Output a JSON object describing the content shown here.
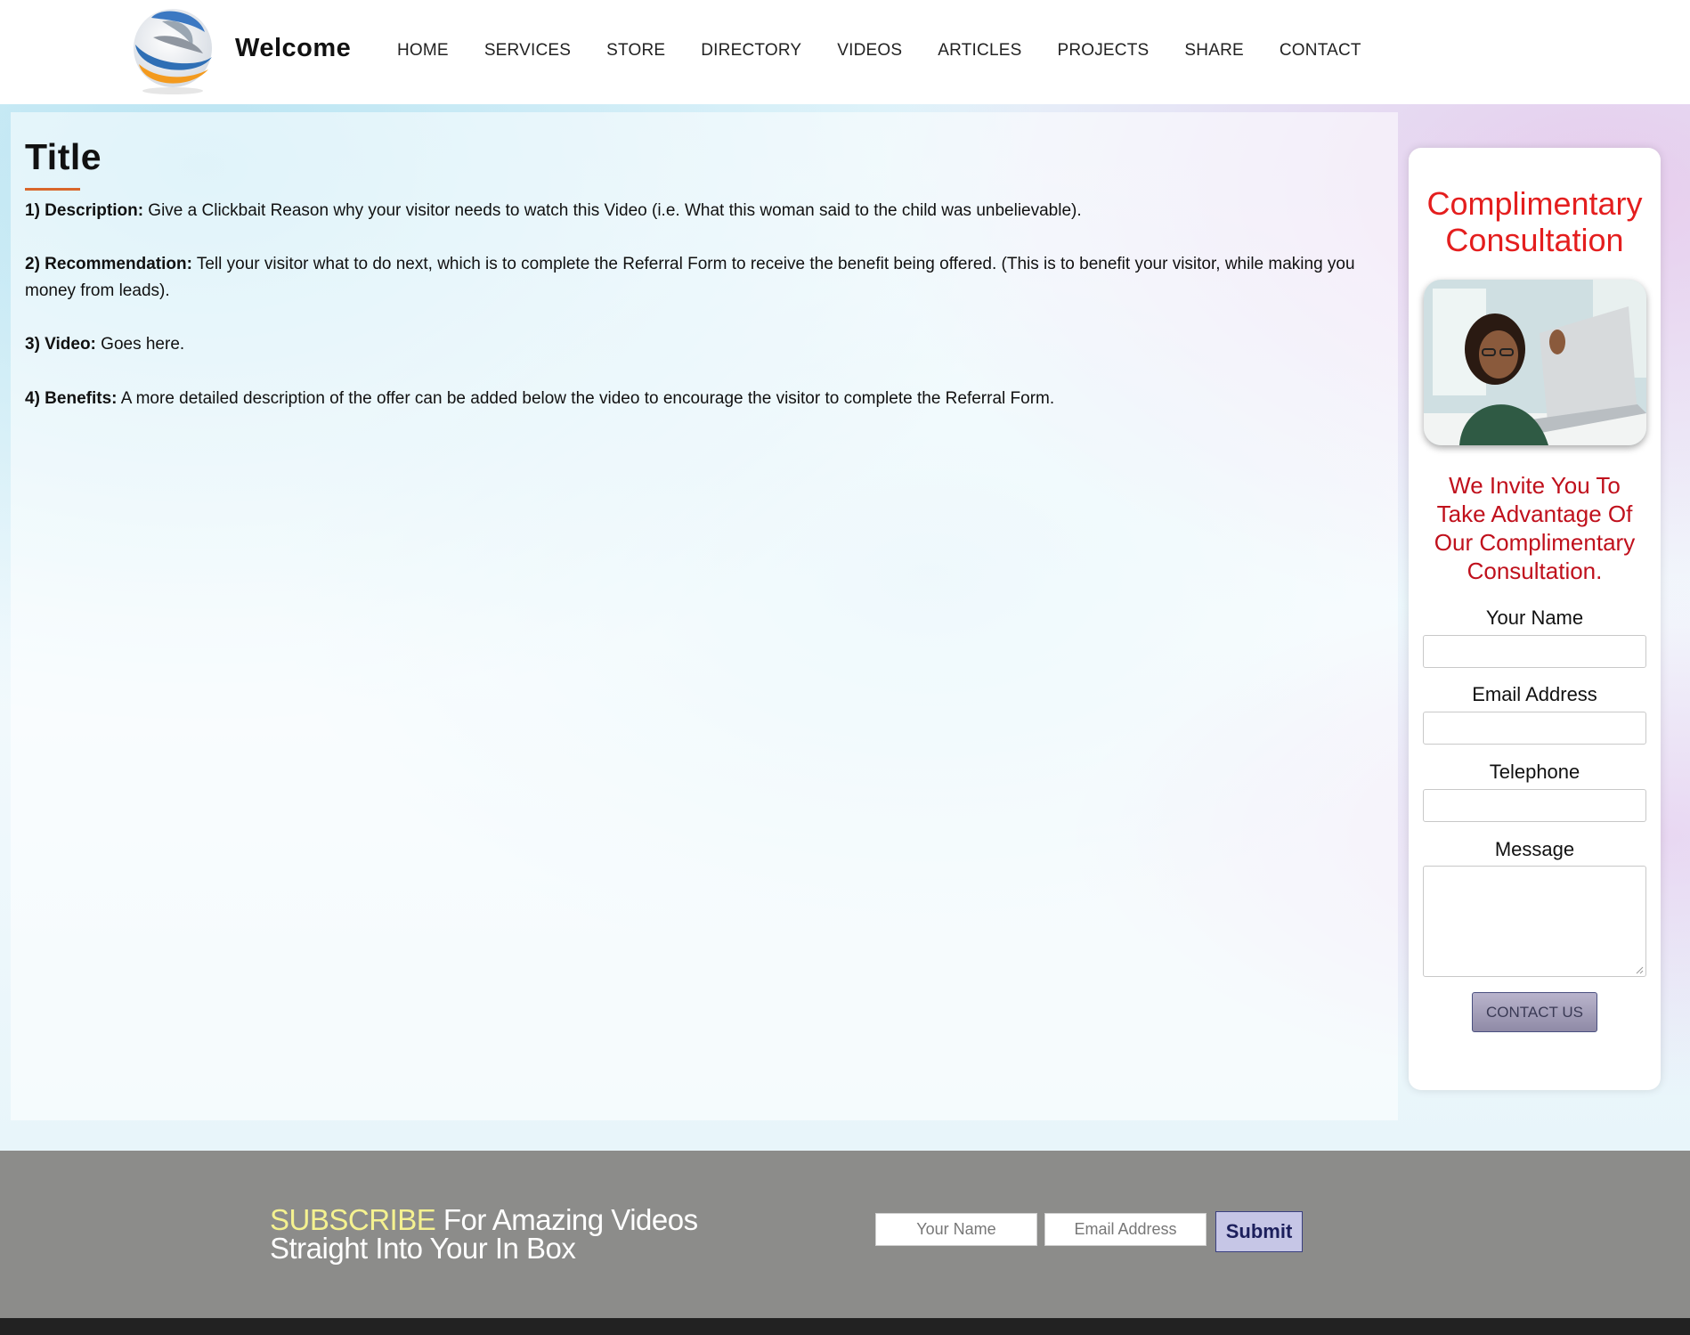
{
  "header": {
    "brand": "Welcome",
    "nav": [
      "HOME",
      "SERVICES",
      "STORE",
      "DIRECTORY",
      "VIDEOS",
      "ARTICLES",
      "PROJECTS",
      "SHARE",
      "CONTACT"
    ]
  },
  "main": {
    "title": "Title",
    "paragraphs": [
      {
        "label": "1) Description:",
        "text": " Give a Clickbait Reason why your visitor needs to watch this Video (i.e. What this woman said to the child was unbelievable)."
      },
      {
        "label": "2) Recommendation:",
        "text": " Tell your visitor what to do next, which is to complete the Referral Form to receive the benefit being offered. (This is to benefit your visitor, while making you money from leads)."
      },
      {
        "label": "3) Video:",
        "text": " Goes here."
      },
      {
        "label": "4) Benefits:",
        "text": " A more detailed description of the offer can be added below the video to encourage the visitor to complete the Referral Form."
      }
    ]
  },
  "sidebar": {
    "heading_line1": "Complimentary",
    "heading_line2": "Consultation",
    "invite_line1": "We Invite You To",
    "invite_line2": "Take Advantage Of",
    "invite_line3": "Our Complimentary",
    "invite_line4": "Consultation.",
    "fields": {
      "name_label": "Your Name",
      "email_label": "Email Address",
      "phone_label": "Telephone",
      "message_label": "Message"
    },
    "button": "CONTACT US"
  },
  "subscribe": {
    "accent": "SUBSCRIBE",
    "line1_rest": " For Amazing Videos",
    "line2": "Straight Into Your In Box",
    "name_placeholder": "Your Name",
    "email_placeholder": "Email Address",
    "submit": "Submit"
  },
  "colors": {
    "title_underline": "#d9662b",
    "sidebar_heading": "#e41e1e",
    "subscribe_bg": "#8c8c8a",
    "subscribe_accent": "#f5f290"
  }
}
